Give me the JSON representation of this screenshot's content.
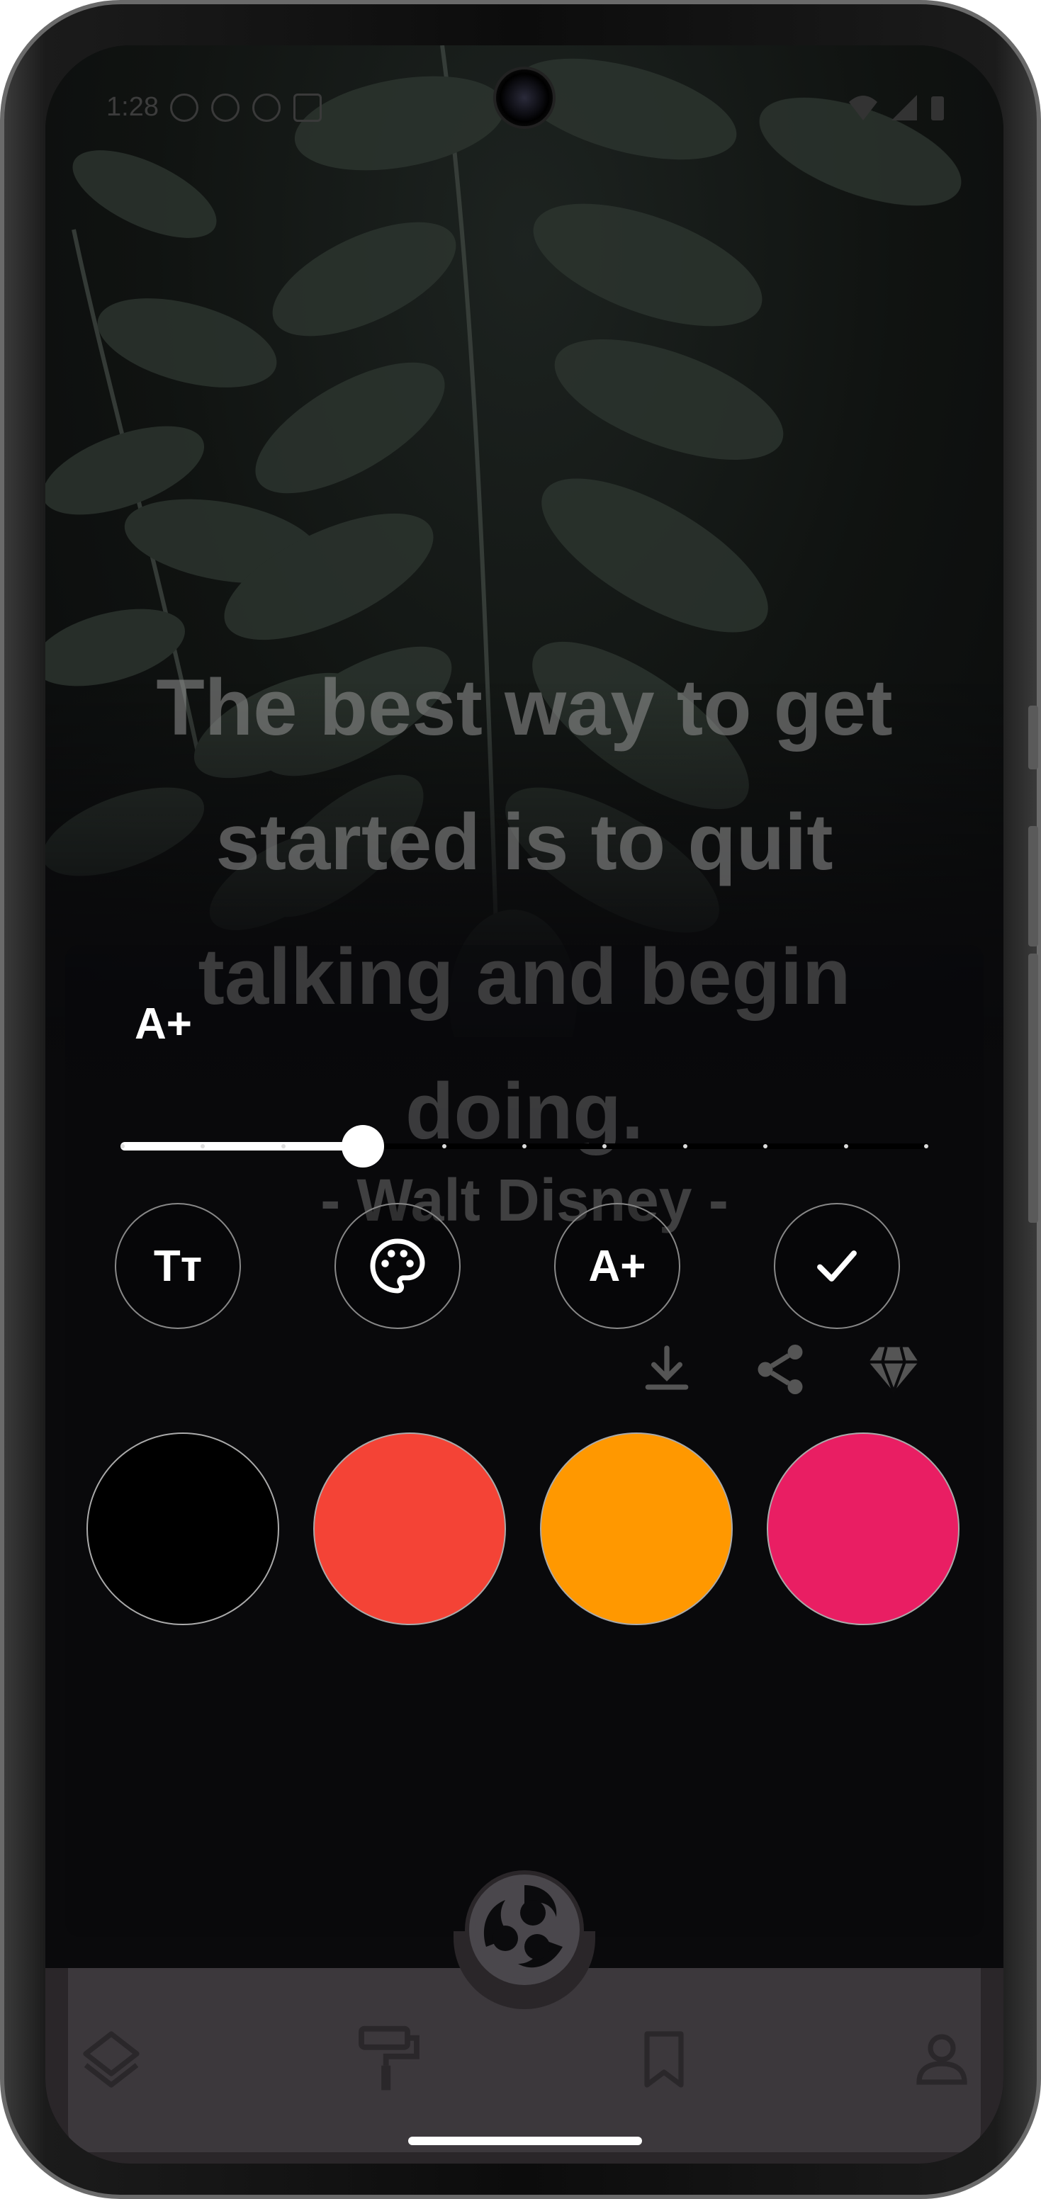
{
  "status_bar": {
    "time": "1:28",
    "icons": [
      "info-icon",
      "shield-icon",
      "bluetooth-icon",
      "a-icon",
      "dot-icon"
    ],
    "right_icons": [
      "wifi-icon",
      "signal-icon",
      "battery-icon"
    ]
  },
  "quote": {
    "text": "The best way to get started is to quit talking and begin doing.",
    "author": "- Walt Disney -"
  },
  "editor": {
    "size_label": "A+",
    "slider": {
      "value_fraction": 0.3,
      "steps": 11
    },
    "tools": [
      {
        "name": "font-style",
        "label": "Tт",
        "icon": "text-style-icon"
      },
      {
        "name": "color",
        "label": "",
        "icon": "palette-icon"
      },
      {
        "name": "size",
        "label": "A+",
        "icon": "text-size-icon"
      },
      {
        "name": "confirm",
        "label": "",
        "icon": "check-icon"
      }
    ],
    "actions": [
      "download-icon",
      "share-icon",
      "diamond-icon"
    ],
    "colors": [
      "#000000",
      "#F44336",
      "#FF9800",
      "#E91E63"
    ]
  },
  "bottom_nav": {
    "items": [
      "layers-icon",
      "paint-roller-icon",
      "bookmark-icon",
      "person-icon"
    ],
    "center": "triskele-icon"
  }
}
